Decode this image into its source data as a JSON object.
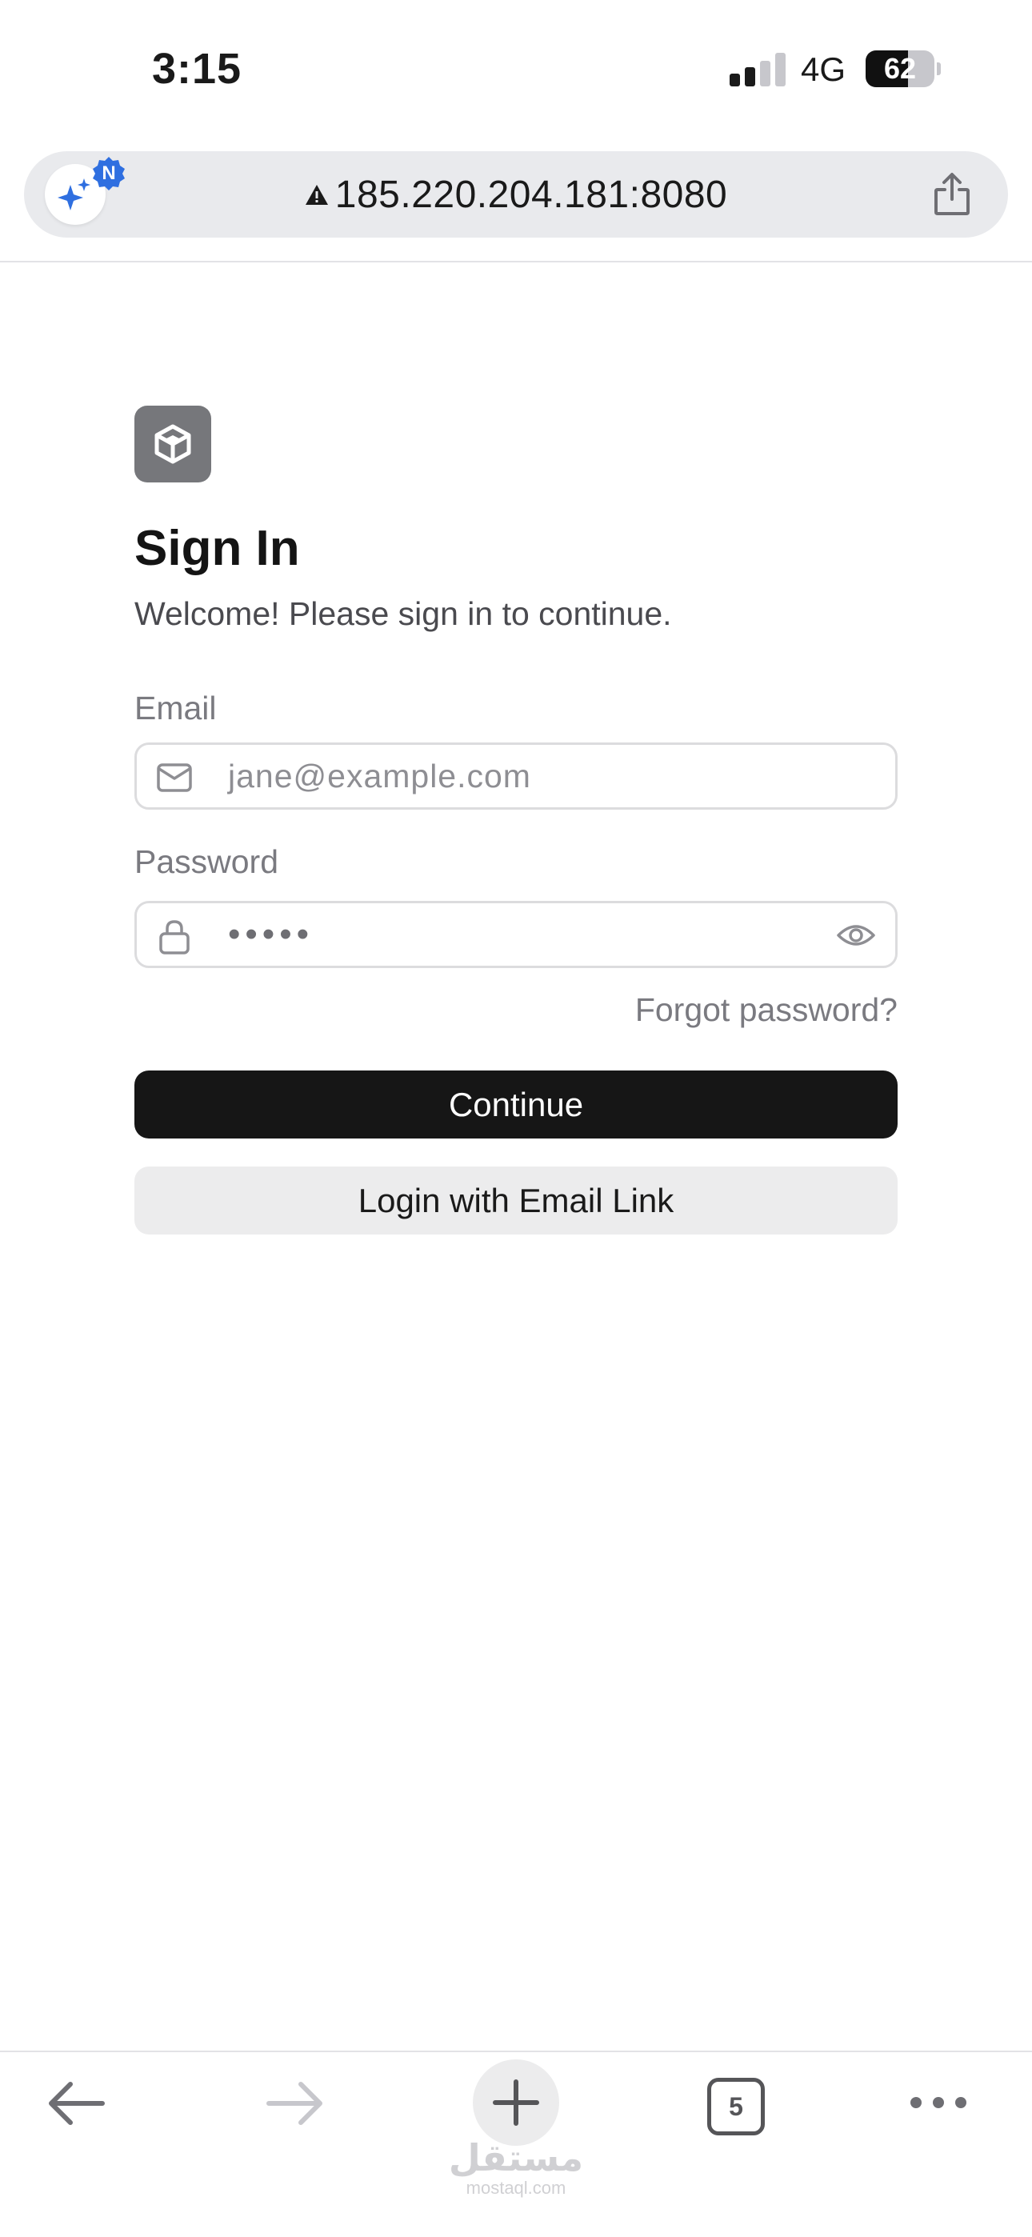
{
  "status_bar": {
    "time": "3:15",
    "network": "4G",
    "battery": "62",
    "battery_level": 0.62
  },
  "browser": {
    "url": "185.220.204.181:8080",
    "security": "not-secure-warning-icon",
    "assistant_badge": "N",
    "accent_color": "#2f6fe0"
  },
  "signin": {
    "title": "Sign In",
    "subtitle": "Welcome! Please sign in to continue.",
    "email_label": "Email",
    "email_placeholder": "jane@example.com",
    "password_label": "Password",
    "password_masked": "•••••",
    "forgot_password": "Forgot password?",
    "continue_label": "Continue",
    "email_link_label": "Login with Email Link"
  },
  "toolbar": {
    "tab_count": "5",
    "icons": [
      "back-arrow-icon",
      "forward-arrow-icon",
      "plus-icon",
      "tabs-icon",
      "more-icon"
    ]
  },
  "watermark": {
    "arabic": "مستقل",
    "latin": "mostaql.com"
  }
}
